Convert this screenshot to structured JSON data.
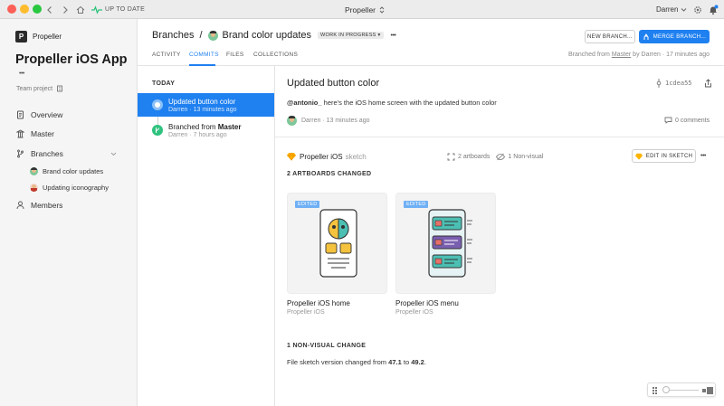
{
  "titlebar": {
    "sync_status": "UP TO DATE",
    "app_title": "Propeller",
    "user": "Darren",
    "colors": {
      "close": "#fc5f57",
      "minimize": "#fdbc2e",
      "maximize": "#28c840",
      "sync": "#2ec27e",
      "notify": "#1f80f0"
    }
  },
  "sidebar": {
    "workspace": "Propeller",
    "project_title": "Propeller iOS App",
    "more": "•••",
    "project_type": "Team project",
    "nav": {
      "overview": "Overview",
      "master": "Master",
      "branches": "Branches",
      "members": "Members"
    },
    "branches": [
      {
        "label": "Brand color updates"
      },
      {
        "label": "Updating iconography"
      }
    ]
  },
  "header": {
    "breadcrumb_root": "Branches",
    "separator": "/",
    "branch_name": "Brand color updates",
    "status_badge": "WORK IN PROGRESS ▾",
    "more": "•••",
    "tabs": {
      "activity": "ACTIVITY",
      "commits": "COMMITS",
      "files": "FILES",
      "collections": "COLLECTIONS"
    },
    "new_branch": "NEW BRANCH...",
    "merge_branch": "MERGE BRANCH...",
    "branched_prefix": "Branched from",
    "branched_source": "Master",
    "branched_suffix": "by Darren · 17 minutes ago",
    "accent": "#1f80f0"
  },
  "commit_list": {
    "group": "TODAY",
    "items": [
      {
        "title": "Updated button color",
        "meta": "Darren · 13 minutes ago"
      },
      {
        "title_prefix": "Branched from",
        "title_bold": "Master",
        "meta": "Darren · 7 hours ago"
      }
    ]
  },
  "detail": {
    "title": "Updated button color",
    "hash": "1cdea55",
    "mention": "@antonio_",
    "message": "here's the iOS home screen with the updated button color",
    "author_meta": "Darren · 13 minutes ago",
    "comments": "0 comments",
    "file": {
      "name": "Propeller iOS",
      "ext": "sketch",
      "artboards": "2 artboards",
      "non_visual": "1 Non-visual",
      "edit_button": "EDIT IN SKETCH",
      "more": "•••"
    },
    "artboards_heading": "2 ARTBOARDS CHANGED",
    "artboards": [
      {
        "badge": "EDITED",
        "name": "Propeller iOS home",
        "file": "Propeller iOS"
      },
      {
        "badge": "EDITED",
        "name": "Propeller iOS menu",
        "file": "Propeller iOS"
      }
    ],
    "nonvisual_heading": "1 NON-VISUAL CHANGE",
    "nonvisual_prefix": "File sketch version changed from",
    "nonvisual_from": "47.1",
    "nonvisual_to_word": "to",
    "nonvisual_to": "49.2",
    "nonvisual_end": "."
  }
}
